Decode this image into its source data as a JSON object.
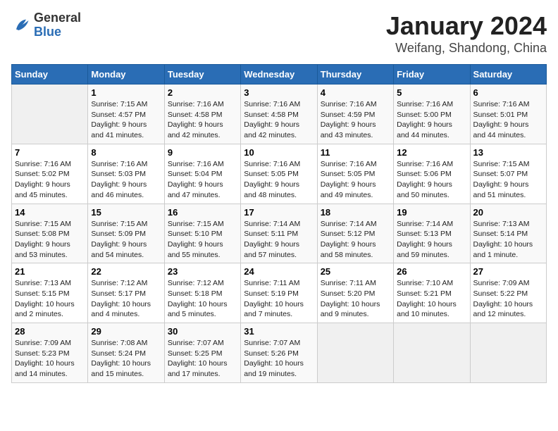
{
  "header": {
    "logo_general": "General",
    "logo_blue": "Blue",
    "title": "January 2024",
    "location": "Weifang, Shandong, China"
  },
  "weekdays": [
    "Sunday",
    "Monday",
    "Tuesday",
    "Wednesday",
    "Thursday",
    "Friday",
    "Saturday"
  ],
  "weeks": [
    [
      {
        "day": "",
        "info": ""
      },
      {
        "day": "1",
        "info": "Sunrise: 7:15 AM\nSunset: 4:57 PM\nDaylight: 9 hours\nand 41 minutes."
      },
      {
        "day": "2",
        "info": "Sunrise: 7:16 AM\nSunset: 4:58 PM\nDaylight: 9 hours\nand 42 minutes."
      },
      {
        "day": "3",
        "info": "Sunrise: 7:16 AM\nSunset: 4:58 PM\nDaylight: 9 hours\nand 42 minutes."
      },
      {
        "day": "4",
        "info": "Sunrise: 7:16 AM\nSunset: 4:59 PM\nDaylight: 9 hours\nand 43 minutes."
      },
      {
        "day": "5",
        "info": "Sunrise: 7:16 AM\nSunset: 5:00 PM\nDaylight: 9 hours\nand 44 minutes."
      },
      {
        "day": "6",
        "info": "Sunrise: 7:16 AM\nSunset: 5:01 PM\nDaylight: 9 hours\nand 44 minutes."
      }
    ],
    [
      {
        "day": "7",
        "info": "Sunrise: 7:16 AM\nSunset: 5:02 PM\nDaylight: 9 hours\nand 45 minutes."
      },
      {
        "day": "8",
        "info": "Sunrise: 7:16 AM\nSunset: 5:03 PM\nDaylight: 9 hours\nand 46 minutes."
      },
      {
        "day": "9",
        "info": "Sunrise: 7:16 AM\nSunset: 5:04 PM\nDaylight: 9 hours\nand 47 minutes."
      },
      {
        "day": "10",
        "info": "Sunrise: 7:16 AM\nSunset: 5:05 PM\nDaylight: 9 hours\nand 48 minutes."
      },
      {
        "day": "11",
        "info": "Sunrise: 7:16 AM\nSunset: 5:05 PM\nDaylight: 9 hours\nand 49 minutes."
      },
      {
        "day": "12",
        "info": "Sunrise: 7:16 AM\nSunset: 5:06 PM\nDaylight: 9 hours\nand 50 minutes."
      },
      {
        "day": "13",
        "info": "Sunrise: 7:15 AM\nSunset: 5:07 PM\nDaylight: 9 hours\nand 51 minutes."
      }
    ],
    [
      {
        "day": "14",
        "info": "Sunrise: 7:15 AM\nSunset: 5:08 PM\nDaylight: 9 hours\nand 53 minutes."
      },
      {
        "day": "15",
        "info": "Sunrise: 7:15 AM\nSunset: 5:09 PM\nDaylight: 9 hours\nand 54 minutes."
      },
      {
        "day": "16",
        "info": "Sunrise: 7:15 AM\nSunset: 5:10 PM\nDaylight: 9 hours\nand 55 minutes."
      },
      {
        "day": "17",
        "info": "Sunrise: 7:14 AM\nSunset: 5:11 PM\nDaylight: 9 hours\nand 57 minutes."
      },
      {
        "day": "18",
        "info": "Sunrise: 7:14 AM\nSunset: 5:12 PM\nDaylight: 9 hours\nand 58 minutes."
      },
      {
        "day": "19",
        "info": "Sunrise: 7:14 AM\nSunset: 5:13 PM\nDaylight: 9 hours\nand 59 minutes."
      },
      {
        "day": "20",
        "info": "Sunrise: 7:13 AM\nSunset: 5:14 PM\nDaylight: 10 hours\nand 1 minute."
      }
    ],
    [
      {
        "day": "21",
        "info": "Sunrise: 7:13 AM\nSunset: 5:15 PM\nDaylight: 10 hours\nand 2 minutes."
      },
      {
        "day": "22",
        "info": "Sunrise: 7:12 AM\nSunset: 5:17 PM\nDaylight: 10 hours\nand 4 minutes."
      },
      {
        "day": "23",
        "info": "Sunrise: 7:12 AM\nSunset: 5:18 PM\nDaylight: 10 hours\nand 5 minutes."
      },
      {
        "day": "24",
        "info": "Sunrise: 7:11 AM\nSunset: 5:19 PM\nDaylight: 10 hours\nand 7 minutes."
      },
      {
        "day": "25",
        "info": "Sunrise: 7:11 AM\nSunset: 5:20 PM\nDaylight: 10 hours\nand 9 minutes."
      },
      {
        "day": "26",
        "info": "Sunrise: 7:10 AM\nSunset: 5:21 PM\nDaylight: 10 hours\nand 10 minutes."
      },
      {
        "day": "27",
        "info": "Sunrise: 7:09 AM\nSunset: 5:22 PM\nDaylight: 10 hours\nand 12 minutes."
      }
    ],
    [
      {
        "day": "28",
        "info": "Sunrise: 7:09 AM\nSunset: 5:23 PM\nDaylight: 10 hours\nand 14 minutes."
      },
      {
        "day": "29",
        "info": "Sunrise: 7:08 AM\nSunset: 5:24 PM\nDaylight: 10 hours\nand 15 minutes."
      },
      {
        "day": "30",
        "info": "Sunrise: 7:07 AM\nSunset: 5:25 PM\nDaylight: 10 hours\nand 17 minutes."
      },
      {
        "day": "31",
        "info": "Sunrise: 7:07 AM\nSunset: 5:26 PM\nDaylight: 10 hours\nand 19 minutes."
      },
      {
        "day": "",
        "info": ""
      },
      {
        "day": "",
        "info": ""
      },
      {
        "day": "",
        "info": ""
      }
    ]
  ]
}
